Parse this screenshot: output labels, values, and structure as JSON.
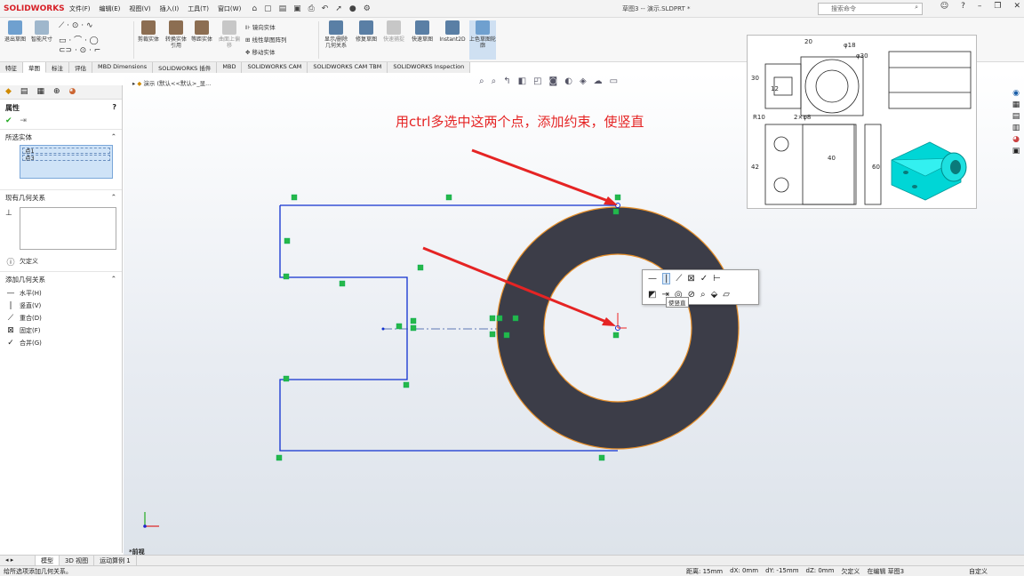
{
  "app": {
    "logo": "SOLIDWORKS",
    "doc_title": "草图3 -- 演示.SLDPRT *",
    "menu": [
      "文件(F)",
      "编辑(E)",
      "视图(V)",
      "插入(I)",
      "工具(T)",
      "窗口(W)"
    ],
    "search_placeholder": "搜索命令"
  },
  "ribbon": {
    "buttons": [
      {
        "label": "退出草图",
        "color": "#6fa0cf"
      },
      {
        "label": "智能尺寸",
        "color": "#9fb7cc"
      },
      {
        "label": "剪裁实体",
        "color": "#8c6e52"
      },
      {
        "label": "转换实体引用",
        "color": "#8c6e52"
      },
      {
        "label": "等距实体",
        "color": "#8c6e52"
      },
      {
        "label": "曲面上偏移",
        "color": "#c7c7c7"
      },
      {
        "label": "显示/删除几何关系",
        "color": "#5a7fa5"
      },
      {
        "label": "修复草图",
        "color": "#5a7fa5"
      },
      {
        "label": "快速捕捉",
        "color": "#c7c7c7"
      },
      {
        "label": "快速草图",
        "color": "#5a7fa5"
      },
      {
        "label": "Instant2D",
        "color": "#5a7fa5"
      },
      {
        "label": "上色草图轮廓",
        "color": "#6fa0cf"
      }
    ],
    "small": [
      "镜向实体",
      "线性草图阵列",
      "移动实体"
    ]
  },
  "tabs": [
    "特征",
    "草图",
    "标注",
    "评估",
    "MBD Dimensions",
    "SOLIDWORKS 插件",
    "MBD",
    "SOLIDWORKS CAM",
    "SOLIDWORKS CAM TBM",
    "SOLIDWORKS Inspection"
  ],
  "active_tab": "草图",
  "left_panel": {
    "title": "属性",
    "selected_section": "所选实体",
    "selected_items": [
      "点1",
      "点3"
    ],
    "existing_section": "现有几何关系",
    "undefined_label": "欠定义",
    "add_section": "添加几何关系",
    "relations": [
      {
        "icon": "—",
        "label": "水平(H)"
      },
      {
        "icon": "|",
        "label": "竖直(V)"
      },
      {
        "icon": "⟋",
        "label": "重合(D)"
      },
      {
        "icon": "⊠",
        "label": "固定(F)"
      },
      {
        "icon": "✓",
        "label": "合并(G)"
      }
    ]
  },
  "graphics": {
    "crumb": "演示 (默认<<默认>_显...",
    "annotation": "用ctrl多选中这两个点，添加约束，使竖直",
    "tooltip": "使竖直",
    "view_name": "*前视"
  },
  "reference": {
    "dims": [
      "20",
      "φ18",
      "φ30",
      "30",
      "12",
      "2×φ8",
      "R10",
      "40",
      "42",
      "60"
    ]
  },
  "bottom_tabs": [
    "模型",
    "3D 视图",
    "运动算例 1"
  ],
  "active_bottom_tab": "模型",
  "status": {
    "message": "给所选项添加几何关系。",
    "distance": "距离: 15mm",
    "dx": "dX: 0mm",
    "dy": "dY: -15mm",
    "dz": "dZ: 0mm",
    "state": "欠定义",
    "editing": "在编辑 草图3",
    "custom": "自定义"
  }
}
